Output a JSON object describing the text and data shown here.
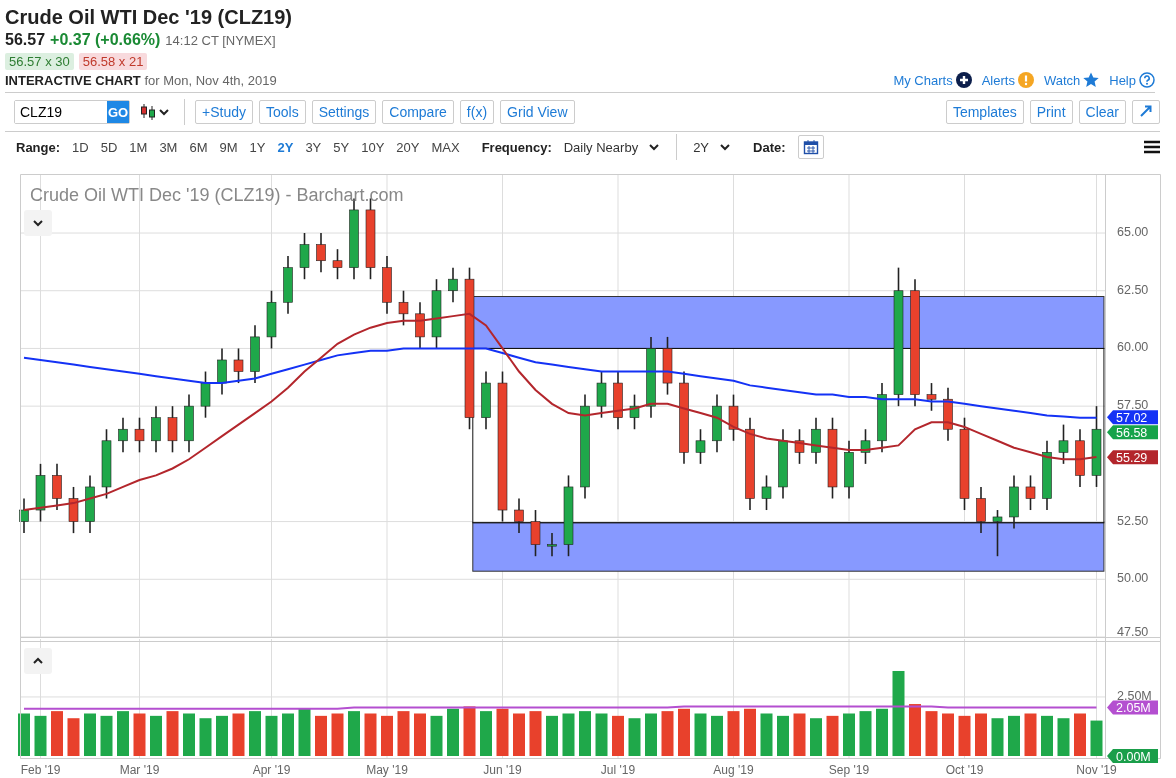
{
  "header": {
    "title": "Crude Oil WTI Dec '19 (CLZ19)",
    "last_price": "56.57",
    "change": "+0.37 (+0.66%)",
    "time": "14:12 CT [NYMEX]",
    "bid": "56.57 x 30",
    "ask": "56.58 x 21",
    "subtitle": "INTERACTIVE CHART",
    "date_text": "for Mon, Nov 4th, 2019"
  },
  "top_links": [
    {
      "label": "My Charts",
      "kind": "plus"
    },
    {
      "label": "Alerts",
      "kind": "alert"
    },
    {
      "label": "Watch",
      "kind": "star"
    },
    {
      "label": "Help",
      "kind": "help"
    }
  ],
  "toolbar": {
    "symbol": "CLZ19",
    "go": "GO",
    "left_buttons": [
      "+Study",
      "Tools",
      "Settings",
      "Compare",
      "f(x)",
      "Grid View"
    ],
    "right_buttons": [
      "Templates",
      "Print",
      "Clear"
    ]
  },
  "range_bar": {
    "label": "Range:",
    "ranges": [
      {
        "label": "1D",
        "selected": false
      },
      {
        "label": "5D",
        "selected": false
      },
      {
        "label": "1M",
        "selected": false
      },
      {
        "label": "3M",
        "selected": false
      },
      {
        "label": "6M",
        "selected": false
      },
      {
        "label": "9M",
        "selected": false
      },
      {
        "label": "1Y",
        "selected": false
      },
      {
        "label": "2Y",
        "selected": true
      },
      {
        "label": "3Y",
        "selected": false
      },
      {
        "label": "5Y",
        "selected": false
      },
      {
        "label": "10Y",
        "selected": false
      },
      {
        "label": "20Y",
        "selected": false
      },
      {
        "label": "MAX",
        "selected": false
      }
    ],
    "frequency_label": "Frequency:",
    "frequency": "Daily Nearby",
    "period": "2Y",
    "date_label": "Date:"
  },
  "price_chart": {
    "chart_data": {
      "type": "candlestick",
      "title": "Crude Oil WTI Dec '19 (CLZ19) - Barchart.com",
      "grid": true,
      "ylim": [
        47.5,
        67.6
      ],
      "yticks": [
        {
          "value": 47.5,
          "label": "47.50"
        },
        {
          "value": 50,
          "label": "50.00"
        },
        {
          "value": 52.5,
          "label": "52.50"
        },
        {
          "value": 57.5,
          "label": "57.50"
        },
        {
          "value": 60,
          "label": "60.00"
        },
        {
          "value": 62.5,
          "label": "62.50"
        },
        {
          "value": 65,
          "label": "65.00"
        }
      ],
      "ohlc": [
        [
          52.5,
          53.5,
          52.0,
          53.0
        ],
        [
          53.0,
          55.0,
          52.5,
          54.5
        ],
        [
          54.5,
          55.0,
          53.0,
          53.5
        ],
        [
          53.5,
          54.0,
          52.0,
          52.5
        ],
        [
          52.5,
          54.5,
          52.0,
          54.0
        ],
        [
          54.0,
          56.5,
          53.5,
          56.0
        ],
        [
          56.0,
          57.0,
          55.5,
          56.5
        ],
        [
          56.5,
          57.0,
          55.5,
          56.0
        ],
        [
          56.0,
          57.5,
          55.5,
          57.0
        ],
        [
          57.0,
          57.5,
          55.5,
          56.0
        ],
        [
          56.0,
          58.0,
          55.5,
          57.5
        ],
        [
          57.5,
          59.0,
          57.0,
          58.5
        ],
        [
          58.5,
          60.0,
          58.0,
          59.5
        ],
        [
          59.5,
          60.0,
          58.5,
          59.0
        ],
        [
          59.0,
          61.0,
          58.5,
          60.5
        ],
        [
          60.5,
          62.5,
          60.0,
          62.0
        ],
        [
          62.0,
          64.0,
          61.5,
          63.5
        ],
        [
          63.5,
          65.0,
          63.0,
          64.5
        ],
        [
          64.5,
          65.0,
          63.3,
          63.8
        ],
        [
          63.8,
          64.3,
          63.0,
          63.5
        ],
        [
          63.5,
          66.5,
          63.0,
          66.0
        ],
        [
          66.0,
          66.5,
          63.0,
          63.5
        ],
        [
          63.5,
          64.0,
          61.5,
          62.0
        ],
        [
          62.0,
          62.5,
          61.0,
          61.5
        ],
        [
          61.5,
          62.0,
          60.0,
          60.5
        ],
        [
          60.5,
          63.0,
          60.0,
          62.5
        ],
        [
          62.5,
          63.5,
          62.0,
          63.0
        ],
        [
          63.0,
          63.5,
          56.5,
          57.0
        ],
        [
          57.0,
          59.0,
          56.5,
          58.5
        ],
        [
          58.5,
          59.0,
          52.5,
          53.0
        ],
        [
          53.0,
          53.5,
          52.0,
          52.5
        ],
        [
          52.5,
          53.0,
          51.0,
          51.5
        ],
        [
          51.5,
          52.0,
          51.0,
          51.5
        ],
        [
          51.5,
          54.5,
          51.0,
          54.0
        ],
        [
          54.0,
          58.0,
          53.5,
          57.5
        ],
        [
          57.5,
          59.0,
          57.0,
          58.5
        ],
        [
          58.5,
          59.0,
          56.5,
          57.0
        ],
        [
          57.0,
          58.0,
          56.5,
          57.5
        ],
        [
          57.5,
          60.5,
          57.0,
          60.0
        ],
        [
          60.0,
          60.5,
          58.0,
          58.5
        ],
        [
          58.5,
          59.0,
          55.0,
          55.5
        ],
        [
          55.5,
          56.5,
          55.0,
          56.0
        ],
        [
          56.0,
          58.0,
          55.5,
          57.5
        ],
        [
          57.5,
          58.0,
          56.0,
          56.5
        ],
        [
          56.5,
          57.0,
          53.0,
          53.5
        ],
        [
          53.5,
          54.5,
          53.0,
          54.0
        ],
        [
          54.0,
          56.5,
          53.5,
          56.0
        ],
        [
          56.0,
          56.5,
          55.0,
          55.5
        ],
        [
          55.5,
          57.0,
          55.0,
          56.5
        ],
        [
          56.5,
          57.0,
          53.5,
          54.0
        ],
        [
          54.0,
          56.0,
          53.5,
          55.5
        ],
        [
          55.5,
          56.5,
          55.0,
          56.0
        ],
        [
          56.0,
          58.5,
          55.5,
          58.0
        ],
        [
          58.0,
          63.5,
          57.5,
          62.5
        ],
        [
          62.5,
          63.0,
          57.5,
          58.0
        ],
        [
          58.0,
          58.5,
          57.3,
          57.8
        ],
        [
          57.8,
          58.3,
          56.0,
          56.5
        ],
        [
          56.5,
          57.0,
          53.0,
          53.5
        ],
        [
          53.5,
          54.0,
          52.0,
          52.5
        ],
        [
          52.5,
          53.0,
          51.0,
          52.7
        ],
        [
          52.7,
          54.5,
          52.2,
          54.0
        ],
        [
          54.0,
          54.5,
          53.0,
          53.5
        ],
        [
          53.5,
          56.0,
          53.0,
          55.5
        ],
        [
          55.5,
          56.7,
          55.0,
          56.0
        ],
        [
          56.0,
          56.5,
          54.0,
          54.5
        ],
        [
          54.5,
          57.5,
          54.0,
          56.5
        ]
      ],
      "series": [
        {
          "type": "line",
          "color": "#1432f5",
          "values": [
            59.6,
            59.5,
            59.4,
            59.3,
            59.2,
            59.1,
            59.0,
            58.9,
            58.8,
            58.7,
            58.6,
            58.5,
            58.5,
            58.6,
            58.7,
            58.9,
            59.1,
            59.3,
            59.5,
            59.7,
            59.8,
            59.9,
            59.9,
            60.0,
            60.0,
            60.0,
            60.0,
            60.0,
            60.0,
            59.8,
            59.6,
            59.4,
            59.3,
            59.2,
            59.1,
            59.0,
            59.0,
            59.0,
            59.0,
            59.0,
            58.9,
            58.8,
            58.7,
            58.6,
            58.4,
            58.3,
            58.2,
            58.1,
            58.0,
            58.0,
            57.9,
            57.9,
            57.8,
            57.8,
            57.8,
            57.7,
            57.7,
            57.6,
            57.5,
            57.4,
            57.3,
            57.2,
            57.1,
            57.05,
            57.0,
            57.0
          ]
        },
        {
          "type": "line",
          "color": "#b3262c",
          "values": [
            53.0,
            53.1,
            53.2,
            53.3,
            53.5,
            53.7,
            54.0,
            54.3,
            54.5,
            54.8,
            55.2,
            55.7,
            56.2,
            56.7,
            57.2,
            57.7,
            58.3,
            59.0,
            59.6,
            60.2,
            60.6,
            60.9,
            61.1,
            61.2,
            61.2,
            61.3,
            61.4,
            61.5,
            61.0,
            60.0,
            59.0,
            58.2,
            57.6,
            57.2,
            57.1,
            57.2,
            57.3,
            57.4,
            57.6,
            57.6,
            57.4,
            57.2,
            57.0,
            56.6,
            56.3,
            56.1,
            56.0,
            55.9,
            55.8,
            55.7,
            55.6,
            55.6,
            55.7,
            55.8,
            56.5,
            56.8,
            56.8,
            56.6,
            56.3,
            56.0,
            55.7,
            55.5,
            55.3,
            55.2,
            55.2,
            55.3
          ]
        }
      ],
      "bands": [
        {
          "axis": "y",
          "from": 60,
          "to": 62.25,
          "color": "#8799ff"
        },
        {
          "axis": "y",
          "from": 50.35,
          "to": 52.45,
          "color": "#8799ff"
        }
      ]
    },
    "axis_tags": [
      {
        "text": "57.02",
        "color": "#1432f5"
      },
      {
        "text": "56.58",
        "color": "#16a34a"
      },
      {
        "text": "55.29",
        "color": "#b3262c"
      }
    ]
  },
  "volume_chart": {
    "chart_data": {
      "type": "bar",
      "grid": true,
      "ylim": [
        0,
        4.87
      ],
      "yticks": [
        {
          "value": 2.5,
          "label": "2.50M"
        }
      ],
      "categories": [
        null,
        "Feb '19",
        null,
        null,
        null,
        null,
        null,
        "Mar '19",
        null,
        null,
        null,
        null,
        null,
        null,
        null,
        "Apr '19",
        null,
        null,
        null,
        null,
        null,
        null,
        "May '19",
        null,
        null,
        null,
        null,
        null,
        null,
        "Jun '19",
        null,
        null,
        null,
        null,
        null,
        null,
        "Jul '19",
        null,
        null,
        null,
        null,
        null,
        null,
        "Aug '19",
        null,
        null,
        null,
        null,
        null,
        null,
        "Sep '19",
        null,
        null,
        null,
        null,
        null,
        null,
        "Oct '19",
        null,
        null,
        null,
        null,
        null,
        null,
        null,
        "Nov '19"
      ],
      "series": [
        {
          "colors": [
            "#1fa84a",
            "#1fa84a",
            "#e8412c",
            "#e8412c",
            "#1fa84a",
            "#1fa84a",
            "#1fa84a",
            "#e8412c",
            "#1fa84a",
            "#e8412c",
            "#1fa84a",
            "#1fa84a",
            "#1fa84a",
            "#e8412c",
            "#1fa84a",
            "#1fa84a",
            "#1fa84a",
            "#1fa84a",
            "#e8412c",
            "#e8412c",
            "#1fa84a",
            "#e8412c",
            "#e8412c",
            "#e8412c",
            "#e8412c",
            "#1fa84a",
            "#1fa84a",
            "#e8412c",
            "#1fa84a",
            "#e8412c",
            "#e8412c",
            "#e8412c",
            "#1fa84a",
            "#1fa84a",
            "#1fa84a",
            "#1fa84a",
            "#e8412c",
            "#1fa84a",
            "#1fa84a",
            "#e8412c",
            "#e8412c",
            "#1fa84a",
            "#1fa84a",
            "#e8412c",
            "#e8412c",
            "#1fa84a",
            "#1fa84a",
            "#e8412c",
            "#1fa84a",
            "#e8412c",
            "#1fa84a",
            "#1fa84a",
            "#1fa84a",
            "#1fa84a",
            "#e8412c",
            "#e8412c",
            "#e8412c",
            "#e8412c",
            "#e8412c",
            "#1fa84a",
            "#1fa84a",
            "#e8412c",
            "#1fa84a",
            "#1fa84a",
            "#e8412c",
            "#1fa84a"
          ],
          "values": [
            1.8,
            1.7,
            1.9,
            1.6,
            1.8,
            1.7,
            1.9,
            1.8,
            1.7,
            1.9,
            1.8,
            1.6,
            1.7,
            1.8,
            1.9,
            1.7,
            1.8,
            2.0,
            1.7,
            1.8,
            1.9,
            1.8,
            1.7,
            1.9,
            1.8,
            1.7,
            2.0,
            2.1,
            1.9,
            2.0,
            1.8,
            1.9,
            1.7,
            1.8,
            1.9,
            1.8,
            1.7,
            1.6,
            1.8,
            1.9,
            2.0,
            1.8,
            1.7,
            1.9,
            2.0,
            1.8,
            1.7,
            1.8,
            1.6,
            1.7,
            1.8,
            1.9,
            2.0,
            3.6,
            2.2,
            1.9,
            1.8,
            1.7,
            1.8,
            1.6,
            1.7,
            1.8,
            1.7,
            1.6,
            1.8,
            1.5
          ]
        },
        {
          "type": "line",
          "color": "#b44fd0",
          "values": [
            2.0,
            2.0,
            2.0,
            2.0,
            2.0,
            2.0,
            2.0,
            2.0,
            2.0,
            2.0,
            2.0,
            2.0,
            2.0,
            2.0,
            2.0,
            2.0,
            2.0,
            2.0,
            2.0,
            2.0,
            2.05,
            2.05,
            2.05,
            2.05,
            2.05,
            2.05,
            2.05,
            2.05,
            2.05,
            2.05,
            2.05,
            2.05,
            2.05,
            2.05,
            2.05,
            2.05,
            2.05,
            2.05,
            2.05,
            2.05,
            2.1,
            2.1,
            2.1,
            2.1,
            2.1,
            2.1,
            2.1,
            2.1,
            2.1,
            2.1,
            2.1,
            2.1,
            2.1,
            2.1,
            2.1,
            2.1,
            2.05,
            2.05,
            2.05,
            2.05,
            2.05,
            2.05,
            2.05,
            2.05,
            2.05,
            2.05
          ]
        }
      ]
    },
    "axis_tags": [
      {
        "text": "2.05M",
        "color": "#b44fd0"
      },
      {
        "text": "0.00M",
        "color": "#1a9e4a"
      }
    ]
  }
}
